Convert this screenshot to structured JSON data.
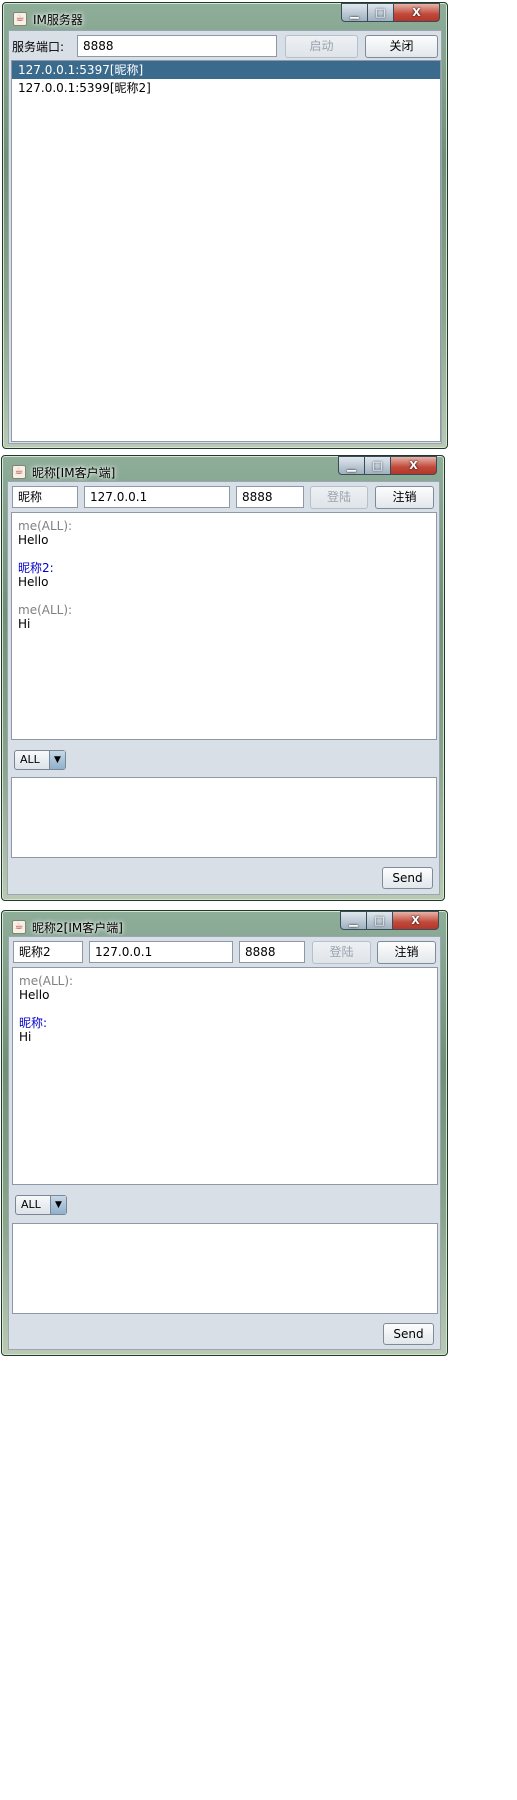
{
  "server": {
    "title": "IM服务器",
    "port_label": "服务端口:",
    "port_value": "8888",
    "start_label": "启动",
    "close_label": "关闭",
    "clients": [
      "127.0.0.1:5397[昵称]",
      "127.0.0.1:5399[昵称2]"
    ],
    "selected_index": 0
  },
  "client1": {
    "title": "昵称[IM客户端]",
    "nickname": "昵称",
    "host": "127.0.0.1",
    "port": "8888",
    "login_label": "登陆",
    "logout_label": "注销",
    "messages": [
      {
        "from": "me(ALL):",
        "text": "Hello",
        "color": "#808080"
      },
      {
        "from": "昵称2:",
        "text": "Hello",
        "color": "#0000cc"
      },
      {
        "from": "me(ALL):",
        "text": "Hi",
        "color": "#808080"
      }
    ],
    "target": "ALL",
    "send_label": "Send"
  },
  "client2": {
    "title": "昵称2[IM客户端]",
    "nickname": "昵称2",
    "host": "127.0.0.1",
    "port": "8888",
    "login_label": "登陆",
    "logout_label": "注销",
    "messages": [
      {
        "from": "me(ALL):",
        "text": "Hello",
        "color": "#808080"
      },
      {
        "from": "昵称:",
        "text": "Hi",
        "color": "#0000cc"
      }
    ],
    "target": "ALL",
    "send_label": "Send"
  },
  "window_controls": {
    "minimize": "▁",
    "maximize": "□",
    "close": "X"
  },
  "icons": {
    "java": "java-icon",
    "dropdown": "▼"
  }
}
